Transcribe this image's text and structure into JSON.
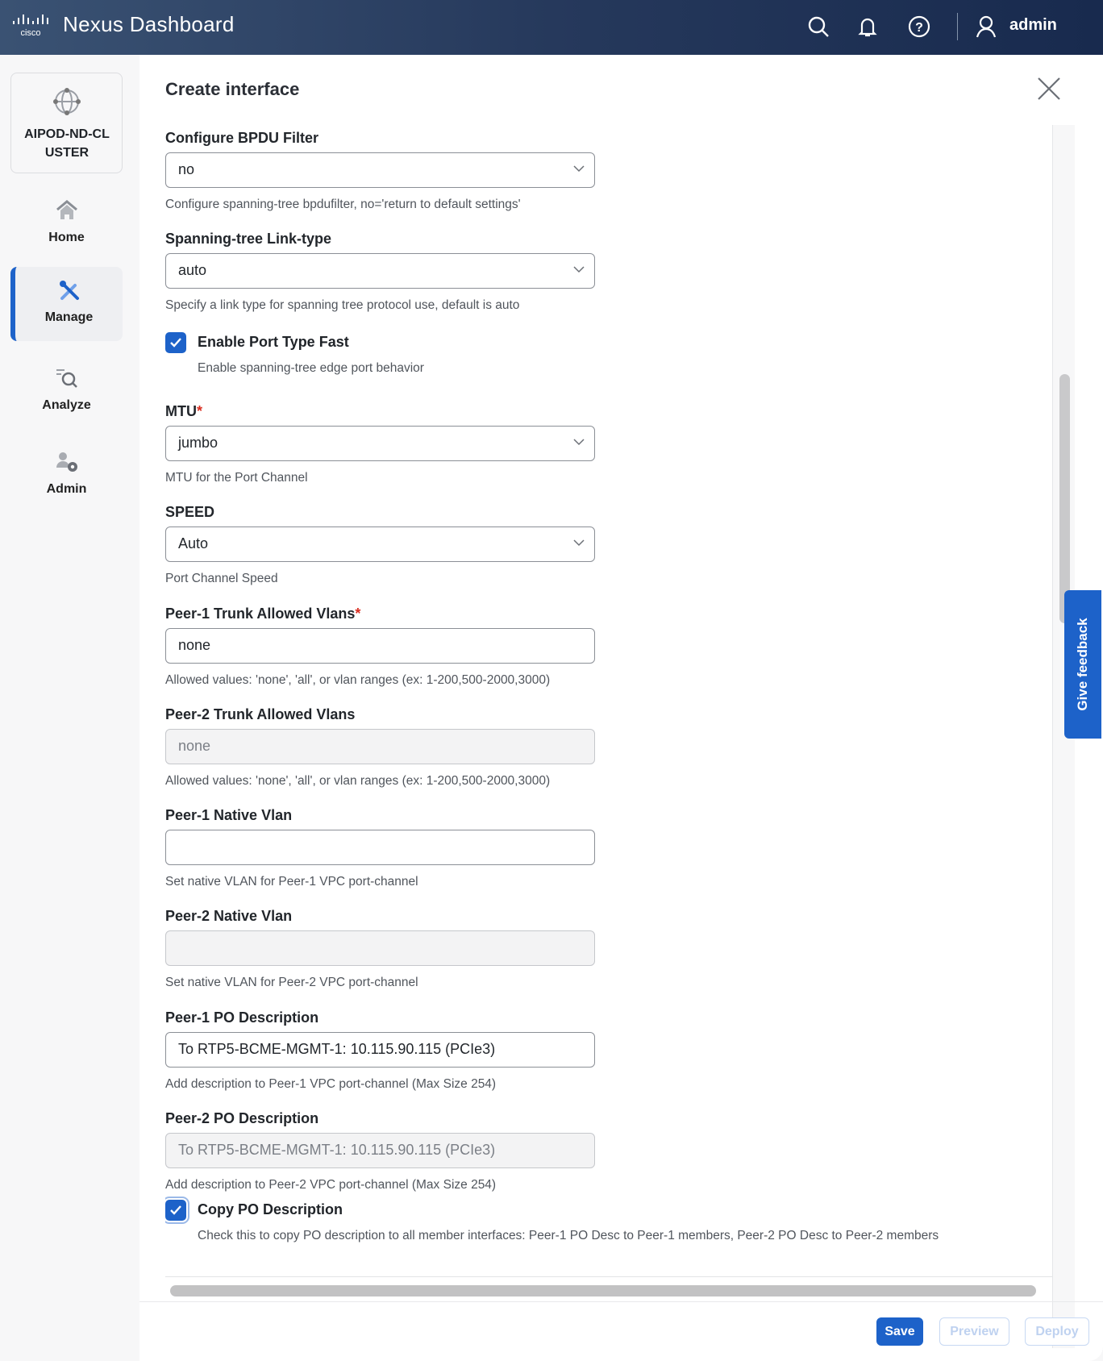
{
  "header": {
    "brand": "cisco",
    "app_title": "Nexus Dashboard",
    "user": "admin"
  },
  "sidebar": {
    "cluster_name": "AIPOD-ND-CLUSTER",
    "items": [
      {
        "label": "Home"
      },
      {
        "label": "Manage",
        "active": true
      },
      {
        "label": "Analyze"
      },
      {
        "label": "Admin"
      }
    ]
  },
  "panel": {
    "title": "Create interface",
    "fields": [
      {
        "label": "Configure BPDU Filter",
        "value": "no",
        "type": "select",
        "help": "Configure spanning-tree bpdufilter, no='return to default settings'"
      },
      {
        "label": "Spanning-tree Link-type",
        "value": "auto",
        "type": "select",
        "help": "Specify a link type for spanning tree protocol use, default is auto"
      },
      {
        "label": "MTU",
        "required": true,
        "value": "jumbo",
        "type": "select",
        "help": "MTU for the Port Channel"
      },
      {
        "label": "SPEED",
        "value": "Auto",
        "type": "select",
        "help": "Port Channel Speed"
      },
      {
        "label": "Peer-1 Trunk Allowed Vlans",
        "required": true,
        "value": "none",
        "type": "text",
        "help": "Allowed values: 'none', 'all', or vlan ranges (ex: 1-200,500-2000,3000)"
      },
      {
        "label": "Peer-2 Trunk Allowed Vlans",
        "value": "none",
        "type": "disabled",
        "help": "Allowed values: 'none', 'all', or vlan ranges (ex: 1-200,500-2000,3000)"
      },
      {
        "label": "Peer-1 Native Vlan",
        "value": "",
        "type": "text",
        "help": "Set native VLAN for Peer-1 VPC port-channel"
      },
      {
        "label": "Peer-2 Native Vlan",
        "value": "",
        "type": "disabled",
        "help": "Set native VLAN for Peer-2 VPC port-channel"
      },
      {
        "label": "Peer-1 PO Description",
        "value": "To RTP5-BCME-MGMT-1: 10.115.90.115 (PCIe3)",
        "type": "text",
        "help": "Add description to Peer-1 VPC port-channel (Max Size 254)"
      },
      {
        "label": "Peer-2 PO Description",
        "value": "To RTP5-BCME-MGMT-1: 10.115.90.115 (PCIe3)",
        "type": "disabled",
        "help": "Add description to Peer-2 VPC port-channel (Max Size 254)"
      }
    ],
    "checkboxes": [
      {
        "label": "Enable Port Type Fast",
        "checked": true,
        "help": "Enable spanning-tree edge port behavior"
      },
      {
        "label": "Copy PO Description",
        "checked": true,
        "help": "Check this to copy PO description to all member interfaces: Peer-1 PO Desc to Peer-1 members, Peer-2 PO Desc to Peer-2 members"
      }
    ]
  },
  "footer": {
    "save": "Save",
    "preview": "Preview",
    "deploy": "Deploy"
  },
  "feedback": "Give feedback",
  "colors": {
    "accent": "#1d62c9",
    "header": "#1e3155"
  }
}
